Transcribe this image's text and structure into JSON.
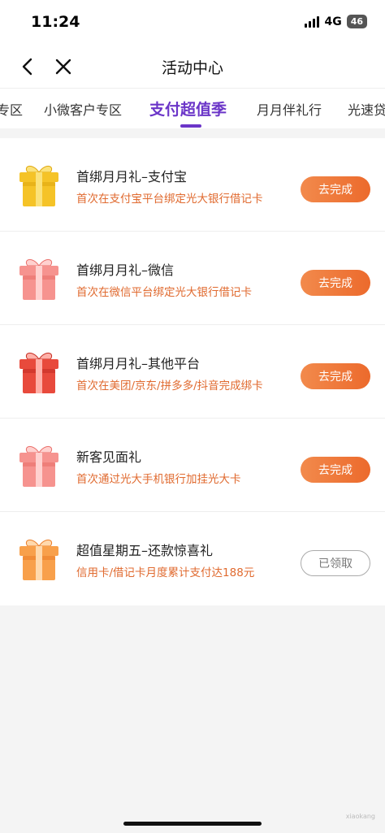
{
  "status_bar": {
    "time": "11:24",
    "network": "4G",
    "battery": "46"
  },
  "nav": {
    "title": "活动中心",
    "back_icon": "chevron-left-icon",
    "close_icon": "close-icon"
  },
  "tabs": [
    {
      "label": "专区"
    },
    {
      "label": "小微客户专区"
    },
    {
      "label": "支付超值季"
    },
    {
      "label": "月月伴礼行"
    },
    {
      "label": "光速贷"
    }
  ],
  "active_tab": "支付超值季",
  "items": [
    {
      "title": "首绑月月礼–支付宝",
      "desc": "首次在支付宝平台绑定光大银行借记卡",
      "button": "去完成",
      "gift_color": "gold"
    },
    {
      "title": "首绑月月礼–微信",
      "desc": "首次在微信平台绑定光大银行借记卡",
      "button": "去完成",
      "gift_color": "pink"
    },
    {
      "title": "首绑月月礼–其他平台",
      "desc": "首次在美团/京东/拼多多/抖音完成绑卡",
      "button": "去完成",
      "gift_color": "red"
    },
    {
      "title": "新客见面礼",
      "desc": "首次通过光大手机银行加挂光大卡",
      "button": "去完成",
      "gift_color": "pink"
    },
    {
      "title": "超值星期五–还款惊喜礼",
      "desc": "信用卡/借记卡月度累计支付达188元",
      "button": "已领取",
      "gift_color": "orange"
    }
  ],
  "colors": {
    "accent": "#6b35c8",
    "action": "#ec6a2c",
    "desc": "#e06a2f"
  }
}
